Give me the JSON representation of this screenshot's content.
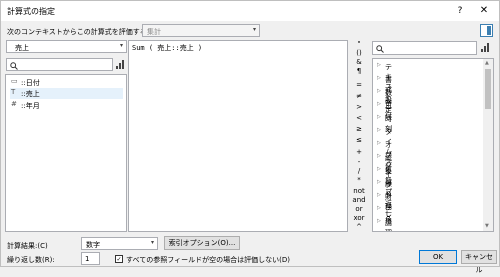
{
  "dialog": {
    "title": "計算式の指定",
    "help": "?",
    "close": "✕"
  },
  "context": {
    "label": "次のコンテキストからこの計算式を評価する(E):",
    "value": "集計"
  },
  "table": {
    "selected": "売上"
  },
  "fields": [
    {
      "icon": "calendar-icon",
      "glyph": "▭",
      "label": "::日付"
    },
    {
      "icon": "text-field-icon",
      "glyph": "T",
      "label": "::売上"
    },
    {
      "icon": "number-field-icon",
      "glyph": "#",
      "label": "::年月"
    }
  ],
  "formula": "Sum ( 売上::売上 )",
  "operators": [
    "\"",
    "()",
    "&",
    "¶",
    "=",
    "≠",
    ">",
    "<",
    "≥",
    "≤",
    "+",
    "-",
    "/",
    "*",
    "not",
    "and",
    "or",
    "xor",
    "^"
  ],
  "categories": [
    "テキスト",
    "書式設定",
    "数字",
    "日付",
    "時刻",
    "タイムスタンプ",
    "オブジェクト",
    "統計",
    "集計",
    "繰り返し",
    "財務",
    "三角",
    "論理"
  ],
  "footer": {
    "result_label": "計算結果:(C)",
    "result_value": "数字",
    "index_button": "索引オプション(O)...",
    "repeat_label": "繰り返し数(R):",
    "repeat_value": "1",
    "checkbox_label": "すべての参照フィールドが空の場合は評価しない(D)",
    "checkbox_checked": true,
    "ok": "OK",
    "cancel": "キャンセル"
  }
}
